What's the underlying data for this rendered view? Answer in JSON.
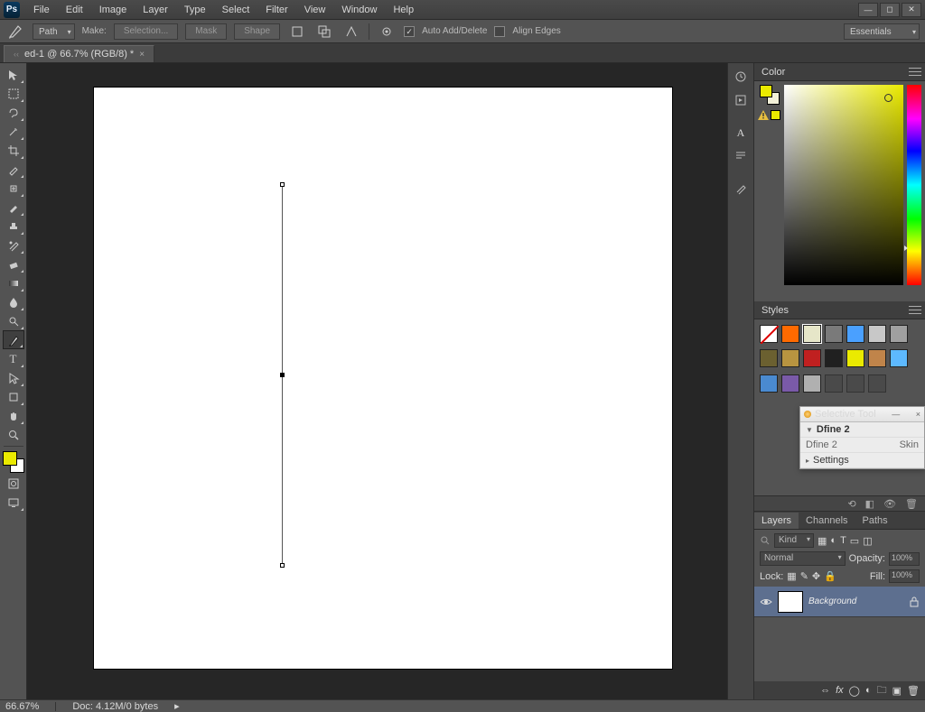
{
  "app": {
    "logo": "Ps"
  },
  "menu": [
    "File",
    "Edit",
    "Image",
    "Layer",
    "Type",
    "Select",
    "Filter",
    "View",
    "Window",
    "Help"
  ],
  "workspace": "Essentials",
  "options": {
    "mode": "Path",
    "make_label": "Make:",
    "selection": "Selection...",
    "mask": "Mask",
    "shape": "Shape",
    "auto_add_delete": "Auto Add/Delete",
    "align_edges": "Align Edges"
  },
  "tab": {
    "title": "ed-1 @ 66.7% (RGB/8) *"
  },
  "colors": {
    "foreground": "#eaea00",
    "background": "#ffffff"
  },
  "panels": {
    "color": "Color",
    "styles": "Styles"
  },
  "styles_swatches": [
    "#ffffff00",
    "#ff6a00",
    "#e6e6c8",
    "#7a7a7a",
    "#4aa0ff",
    "#c8c8c8",
    "#a0a0a0",
    "#6b6030",
    "#b89440",
    "#c02020",
    "#202020",
    "#eaea00",
    "#c0844a",
    "#5db9ff",
    "#4a8ad0",
    "#7a5aa8",
    "#b0b0b0",
    "none",
    "none",
    "none"
  ],
  "selective": {
    "title": "Selective Tool",
    "row1": "Dfine 2",
    "row2a": "Dfine 2",
    "row2b": "Skin",
    "row3": "Settings"
  },
  "layers": {
    "tabs": [
      "Layers",
      "Channels",
      "Paths"
    ],
    "kind": "Kind",
    "blend": "Normal",
    "opacity_label": "Opacity:",
    "opacity": "100%",
    "lock_label": "Lock:",
    "fill_label": "Fill:",
    "fill": "100%",
    "items": [
      {
        "name": "Background"
      }
    ]
  },
  "status": {
    "zoom": "66.67%",
    "doc": "Doc: 4.12M/0 bytes"
  }
}
